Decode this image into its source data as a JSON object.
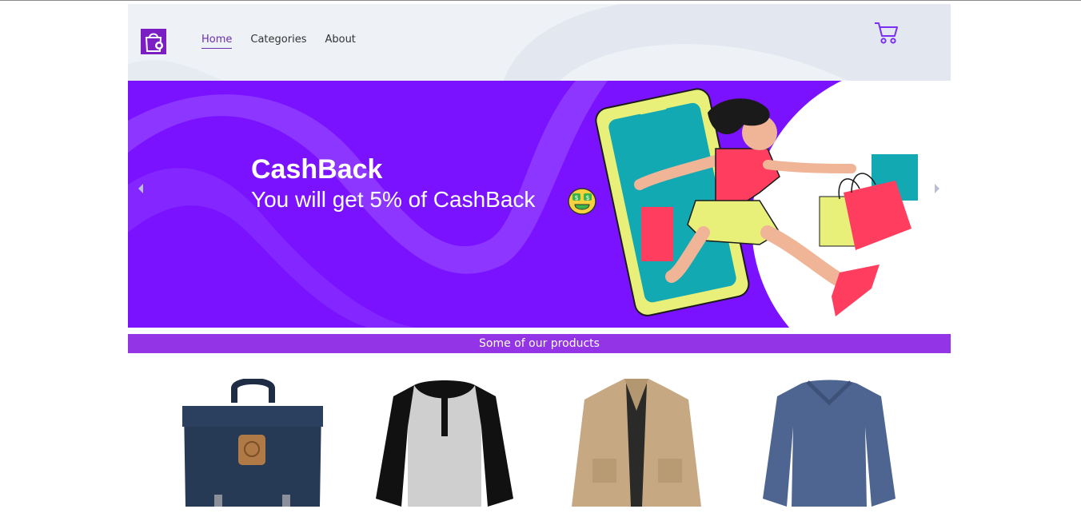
{
  "nav": {
    "items": [
      {
        "label": "Home",
        "active": true
      },
      {
        "label": "Categories",
        "active": false
      },
      {
        "label": "About",
        "active": false
      }
    ]
  },
  "icons": {
    "logo": "shopping-bag-icon",
    "cart": "shopping-cart-icon",
    "prev": "chevron-left-icon",
    "next": "chevron-right-icon",
    "emoji": "money-mouth-face-icon"
  },
  "banner": {
    "title": "CashBack",
    "subtitle": "You will get 5% of CashBack"
  },
  "section": {
    "title": "Some of our products"
  },
  "products": [
    {
      "name": "backpack-product-image"
    },
    {
      "name": "raglan-tshirt-product-image"
    },
    {
      "name": "khaki-jacket-product-image"
    },
    {
      "name": "blue-sweater-product-image"
    }
  ],
  "colors": {
    "accent": "#7a12ff",
    "section_bar": "#9334e6",
    "nav_active": "#6a2fb4",
    "header_bg": "#eef1f6"
  }
}
